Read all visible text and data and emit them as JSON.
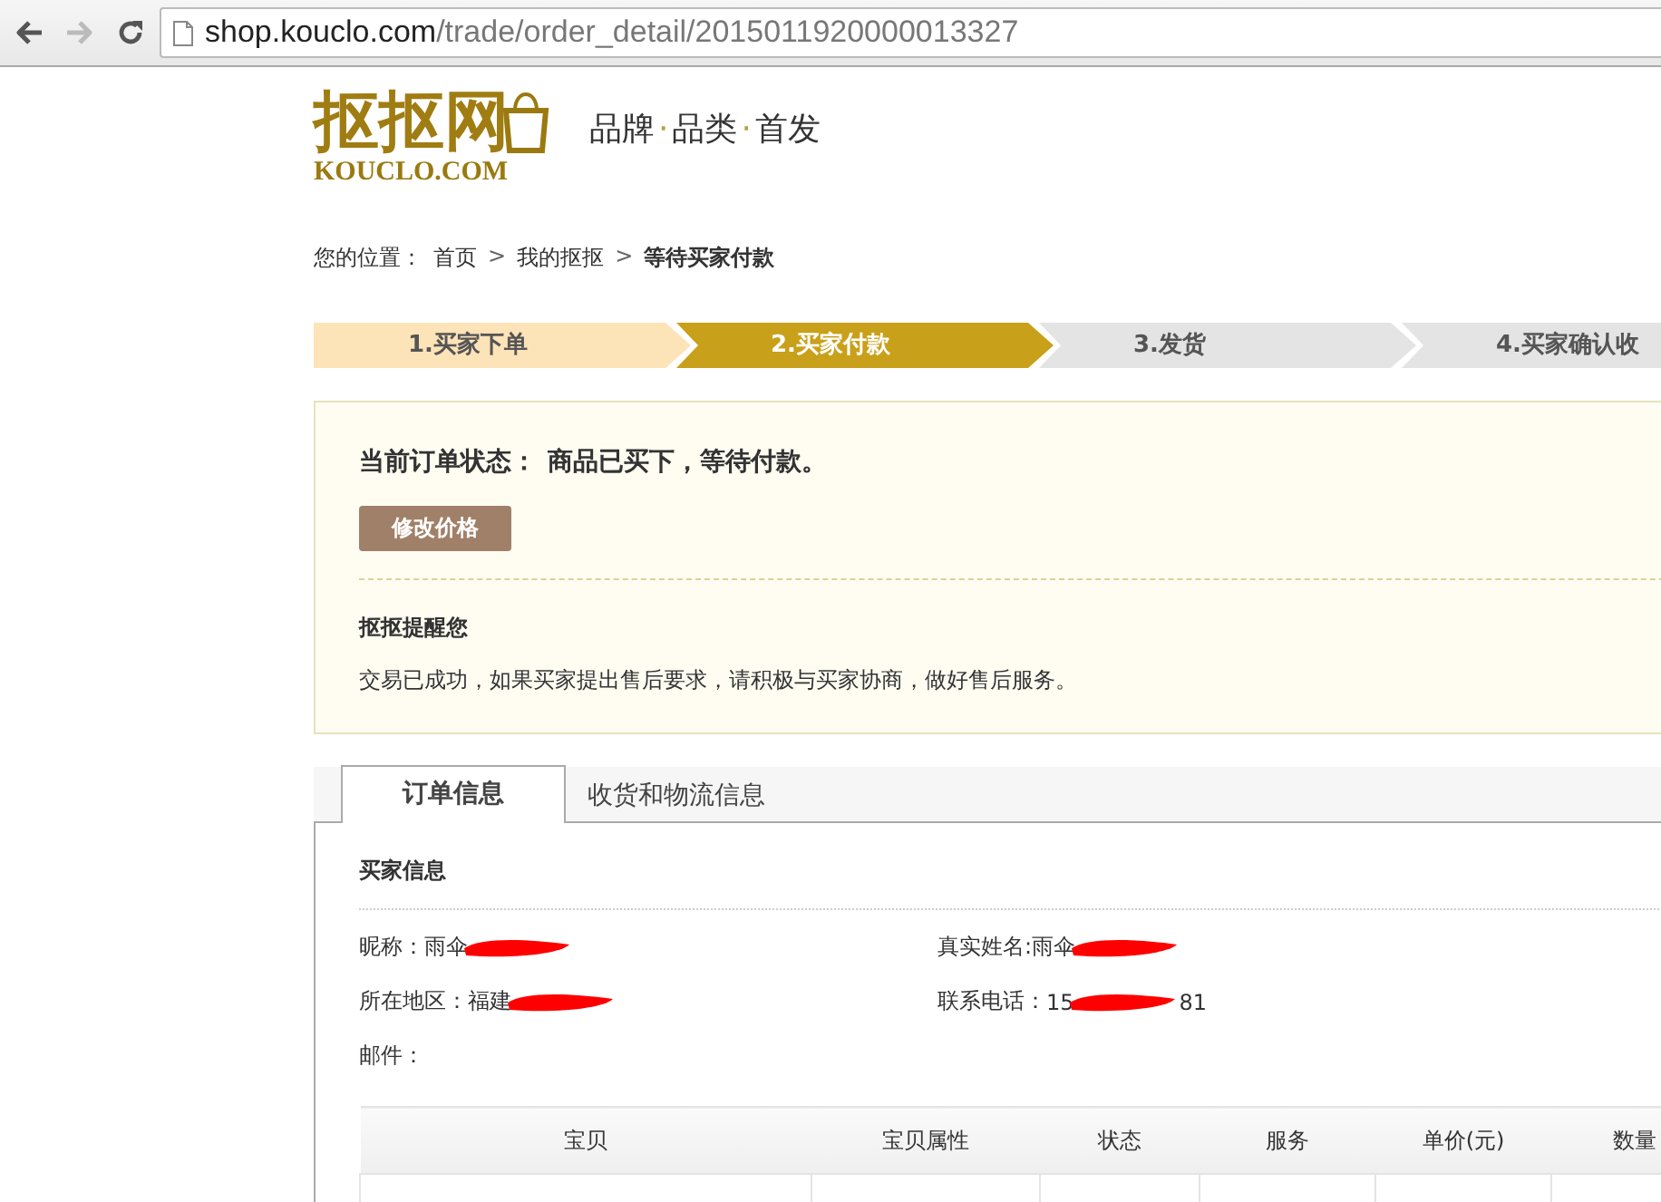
{
  "browser": {
    "nav_buttons": [
      {
        "kind": "back",
        "disabled": false
      },
      {
        "kind": "forward",
        "disabled": true
      },
      {
        "kind": "reload",
        "disabled": false
      }
    ],
    "address": {
      "host": "shop.kouclo.com",
      "path": "/trade/order_detail/2015011920000013327"
    }
  },
  "header": {
    "logo": {
      "name": "抠抠网",
      "domain": "KOUCLO.COM"
    },
    "slogan": {
      "words": [
        "品牌",
        "品类",
        "首发"
      ],
      "separator": "·"
    }
  },
  "breadcrumb": {
    "label": "您的位置：",
    "separator": ">",
    "items": [
      {
        "text": "首页",
        "current": false
      },
      {
        "text": "我的抠抠",
        "current": false
      },
      {
        "text": "等待买家付款",
        "current": true
      }
    ]
  },
  "steps": [
    {
      "label": "1.买家下单",
      "done": true,
      "selected": false
    },
    {
      "label": "2.买家付款",
      "done": false,
      "selected": true
    },
    {
      "label": "3.发货",
      "done": false,
      "selected": false
    },
    {
      "label": "4.买家确认收",
      "done": false,
      "selected": false
    }
  ],
  "status_panel": {
    "status_label": "当前订单状态：",
    "status_text": "商品已买下，等待付款。",
    "button": "修改价格",
    "reminder_title": "抠抠提醒您",
    "reminder_text": "交易已成功，如果买家提出售后要求，请积极与买家协商，做好售后服务。"
  },
  "tabs": [
    {
      "label": "订单信息",
      "selected": true
    },
    {
      "label": "收货和物流信息",
      "selected": false
    }
  ],
  "buyer": {
    "title": "买家信息",
    "fields": [
      {
        "label": "昵称：",
        "value": "雨伞",
        "redacted": true
      },
      {
        "label": "真实姓名:",
        "value": "雨伞",
        "redacted": true
      },
      {
        "label": "所在地区：",
        "value": "福建",
        "redacted": true
      },
      {
        "label": "联系电话：",
        "value": "15",
        "redacted": true,
        "suffix": "81"
      },
      {
        "label": "邮件：",
        "redacted": false
      }
    ]
  },
  "table": {
    "columns": [
      "宝贝",
      "宝贝属性",
      "状态",
      "服务",
      "单价(元)",
      "数量"
    ]
  }
}
